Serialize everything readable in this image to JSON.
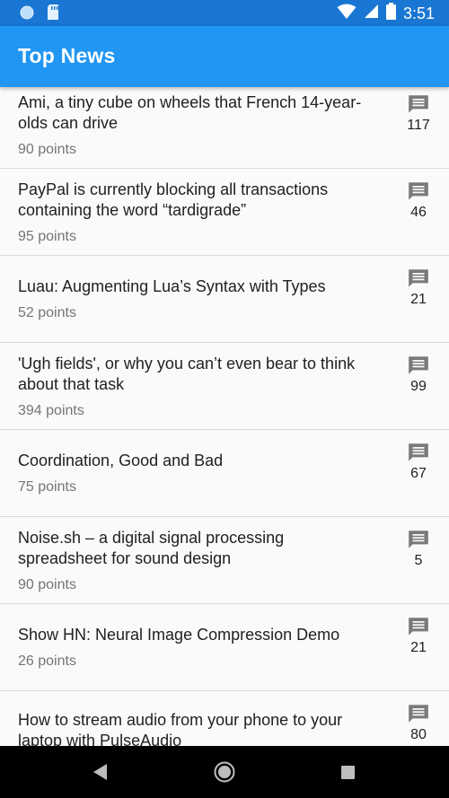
{
  "status_bar": {
    "time": "3:51",
    "bg_color": "#1976d2"
  },
  "app_bar": {
    "title": "Top News",
    "bg_color": "#2196f3"
  },
  "news": [
    {
      "title": "Ami, a tiny cube on wheels that French 14-year-olds can drive",
      "points": "90 points",
      "comments": "117"
    },
    {
      "title": "PayPal is currently blocking all transactions containing the word “tardigrade”",
      "points": "95 points",
      "comments": "46"
    },
    {
      "title": "Luau: Augmenting Lua’s Syntax with Types",
      "points": "52 points",
      "comments": "21"
    },
    {
      "title": "'Ugh fields', or why you can’t even bear to think about that task",
      "points": "394 points",
      "comments": "99"
    },
    {
      "title": "Coordination, Good and Bad",
      "points": "75 points",
      "comments": "67"
    },
    {
      "title": "Noise.sh – a digital signal processing spreadsheet for sound design",
      "points": "90 points",
      "comments": "5"
    },
    {
      "title": "Show HN: Neural Image Compression Demo",
      "points": "26 points",
      "comments": "21"
    },
    {
      "title": "How to stream audio from your phone to your laptop with PulseAudio",
      "points": "",
      "comments": "80"
    }
  ],
  "icons": {
    "comment": "comment-icon",
    "wifi": "wifi-icon",
    "signal": "signal-icon",
    "battery": "battery-icon",
    "back": "back-icon",
    "home": "home-icon",
    "recents": "recents-icon"
  }
}
